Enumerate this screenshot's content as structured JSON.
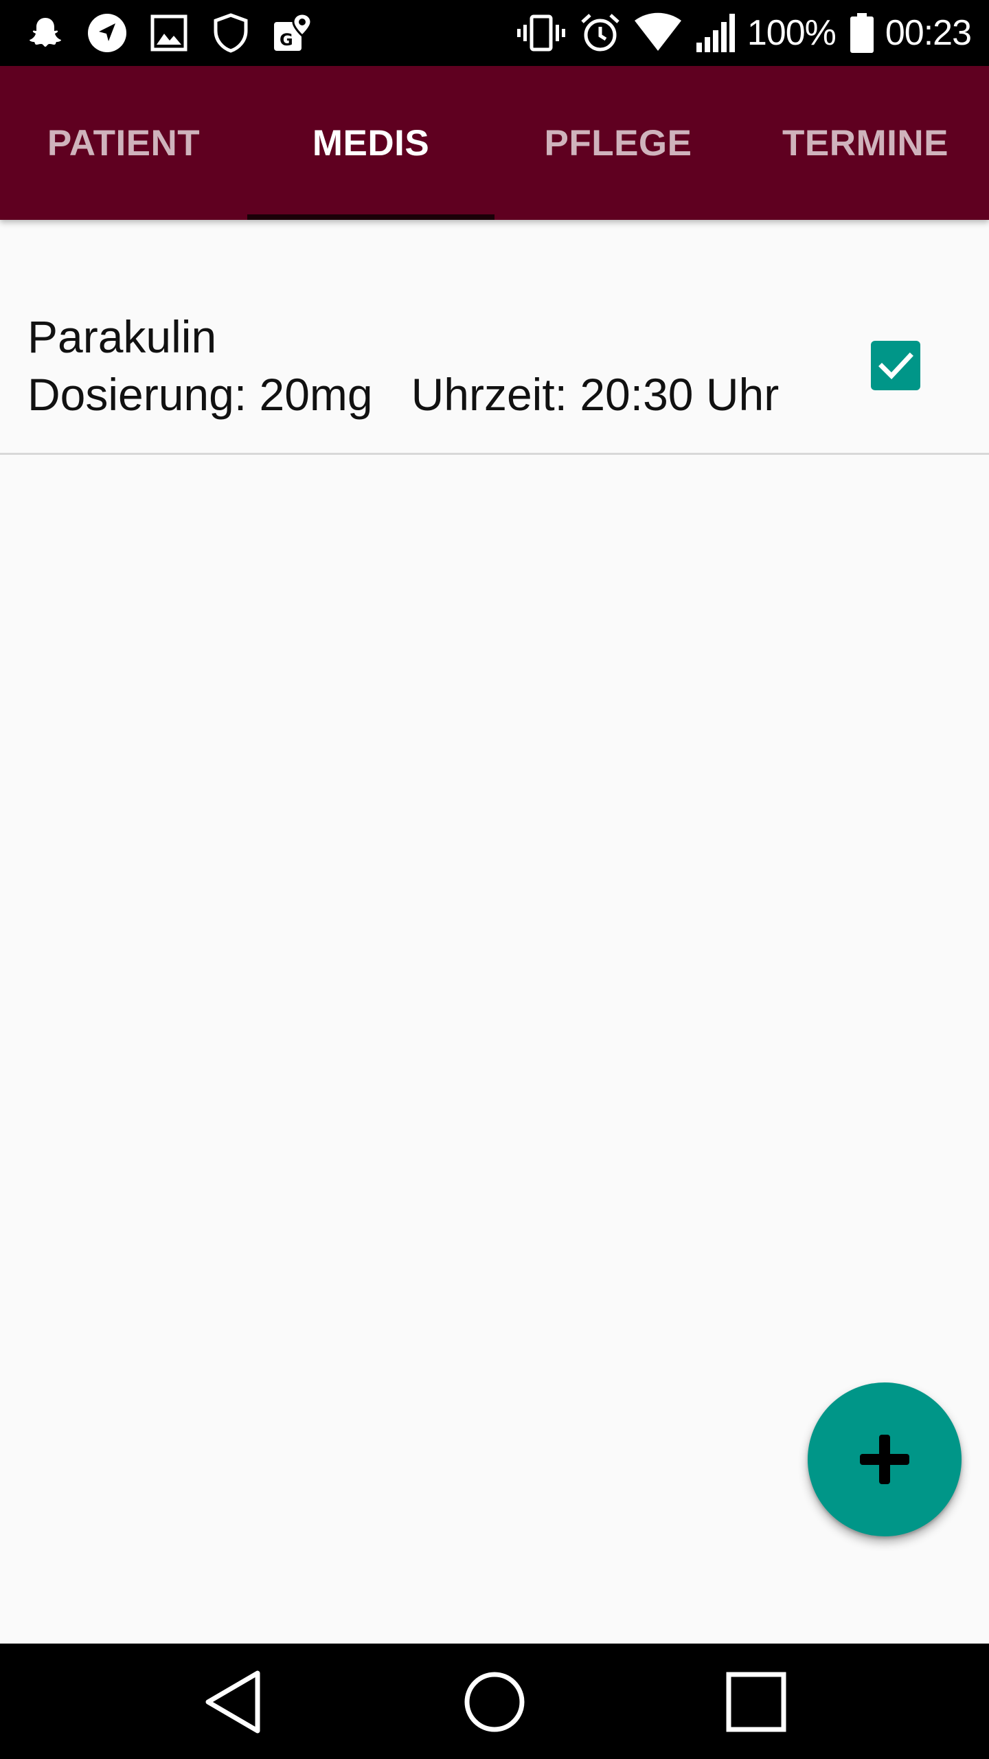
{
  "status_bar": {
    "battery_percent": "100%",
    "time": "00:23",
    "left_icons": [
      "snapchat-icon",
      "navigation-arrow-icon",
      "image-icon",
      "shield-icon",
      "maps-pin-icon"
    ],
    "right_icons": [
      "vibrate-icon",
      "alarm-icon",
      "wifi-icon",
      "signal-icon",
      "battery-icon"
    ]
  },
  "tabs": [
    {
      "label": "PATIENT",
      "active": false
    },
    {
      "label": "MEDIS",
      "active": true
    },
    {
      "label": "PFLEGE",
      "active": false
    },
    {
      "label": "TERMINE",
      "active": false
    }
  ],
  "medications": [
    {
      "name": "Parakulin",
      "dosage": "Dosierung: 20mg",
      "time": "Uhrzeit: 20:30 Uhr",
      "checked": true
    }
  ],
  "fab": {
    "icon": "plus-icon"
  },
  "nav_bar": {
    "icons": [
      "back-icon",
      "home-icon",
      "recents-icon"
    ]
  },
  "colors": {
    "tab_bar": "#5f0020",
    "accent": "#009688",
    "background": "#fafafa"
  }
}
